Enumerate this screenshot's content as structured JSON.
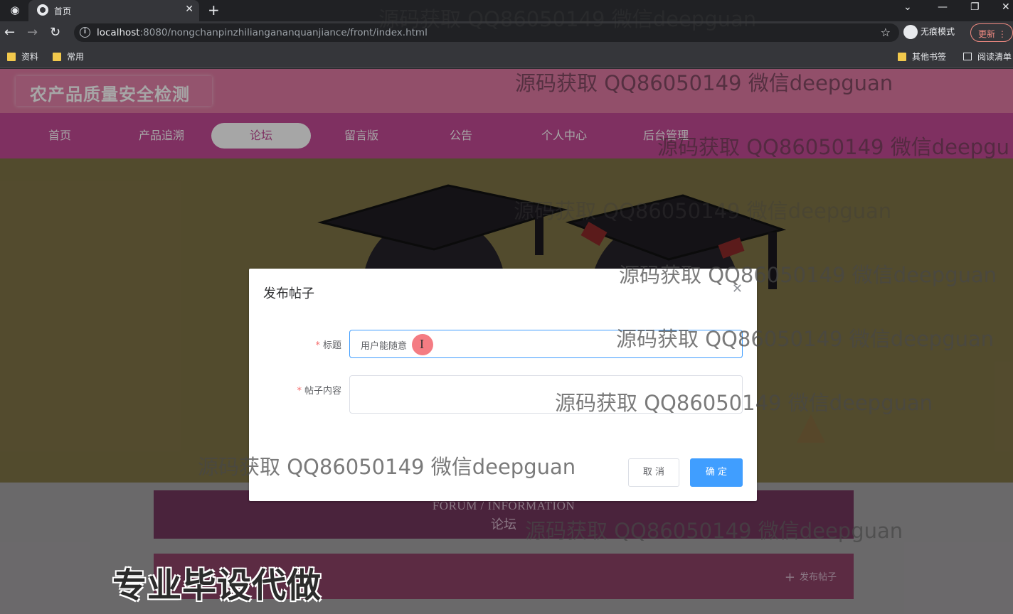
{
  "browser": {
    "tab_title": "首页",
    "url_host": "localhost",
    "url_rest": ":8080/nongchanpinzhiliangananquanjiance/front/index.html",
    "incognito_label": "无痕模式",
    "update_label": "更新",
    "bookmarks": [
      "资料",
      "常用"
    ],
    "bookmarks_right": [
      "其他书签",
      "阅读清单"
    ]
  },
  "site": {
    "logo": "农产品质量安全检测",
    "nav": [
      "首页",
      "产品追溯",
      "论坛",
      "留言版",
      "公告",
      "个人中心",
      "后台管理"
    ],
    "active_nav": "论坛",
    "section_en": "FORUM / INFORMATION",
    "section_cn": "论坛",
    "post_button": "发布帖子"
  },
  "dialog": {
    "title": "发布帖子",
    "title_label": "标题",
    "title_value": "用户能随意",
    "content_label": "帖子内容",
    "content_value": "",
    "cancel_label": "取 消",
    "ok_label": "确 定"
  },
  "overlay_text": {
    "watermark": "源码获取 QQ86050149 微信deepguan",
    "watermark_cut": "源码获取 QQ86050149 微信deepgu",
    "promo": "专业毕设代做"
  },
  "colors": {
    "header_pink": "#e07aa3",
    "nav_magenta": "#c34a96",
    "primary_blue": "#409eff"
  }
}
